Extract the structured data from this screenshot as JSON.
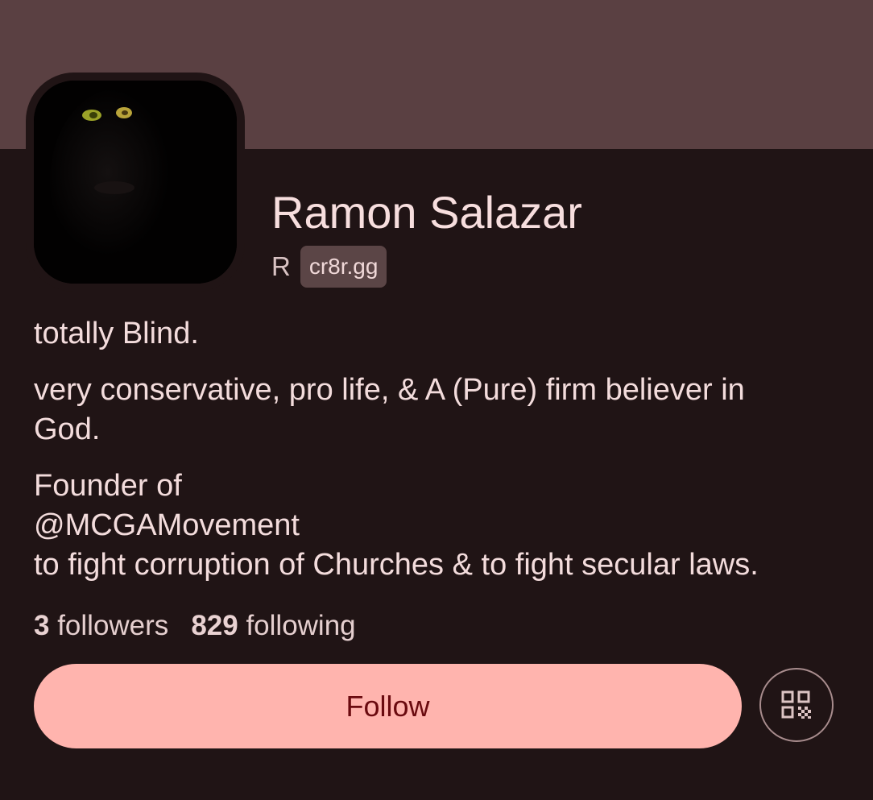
{
  "profile": {
    "display_name": "Ramon Salazar",
    "handle_initial": "R",
    "domain": "cr8r.gg",
    "avatar_icon": "profile-photo"
  },
  "bio": {
    "line1": "totally Blind.",
    "line2": "very conservative, pro life, & A (Pure) firm believer in",
    "line2b": "God.",
    "line3a": "Founder of",
    "line3b": "@MCGAMovement",
    "line3c": "to fight corruption of Churches & to fight secular laws."
  },
  "stats": {
    "followers_count": "3",
    "followers_label": "followers",
    "following_count": "829",
    "following_label": "following"
  },
  "actions": {
    "follow_label": "Follow",
    "qr_icon": "qr-code-icon"
  },
  "colors": {
    "banner": "#5a4042",
    "background": "#201415",
    "follow_button": "#ffb4ae",
    "follow_text": "#6a0a0f"
  }
}
